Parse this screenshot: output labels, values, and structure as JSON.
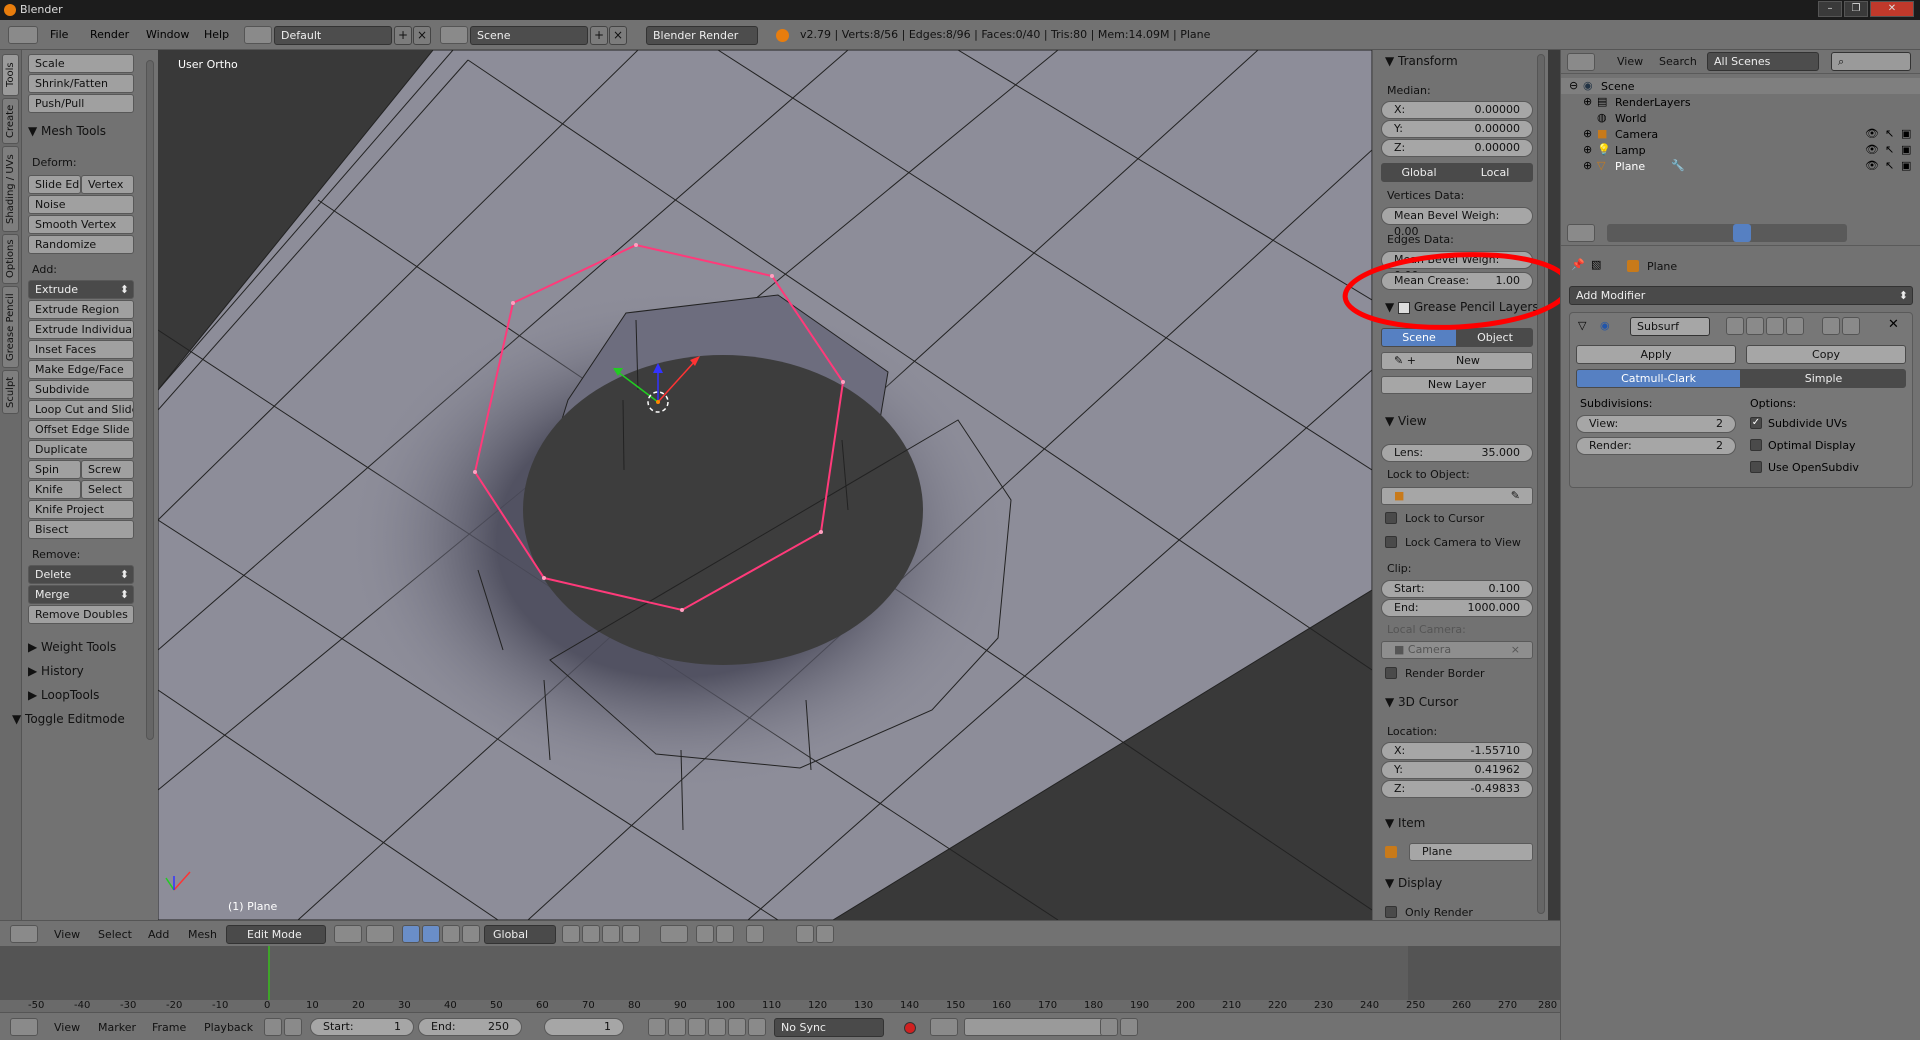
{
  "titlebar": {
    "title": "Blender",
    "min": "–",
    "max": "❐",
    "close": "✕"
  },
  "info": {
    "menus": [
      "File",
      "Render",
      "Window",
      "Help"
    ],
    "layout": "Default",
    "scene": "Scene",
    "engine": "Blender Render",
    "stats": "v2.79 | Verts:8/56 | Edges:8/96 | Faces:0/40 | Tris:80 | Mem:14.09M | Plane"
  },
  "tabs": [
    "Tools",
    "Create",
    "Shading / UVs",
    "Options",
    "Grease Pencil",
    "Sculpt"
  ],
  "tools": {
    "top_buttons": [
      "Scale",
      "Shrink/Fatten",
      "Push/Pull"
    ],
    "mesh_tools": "Mesh Tools",
    "deform": "Deform:",
    "deform_pair": [
      "Slide Ed",
      "Vertex"
    ],
    "deform_buttons": [
      "Noise",
      "Smooth Vertex",
      "Randomize"
    ],
    "add": "Add:",
    "extrude": "Extrude",
    "add_buttons": [
      "Extrude Region",
      "Extrude Individual",
      "Inset Faces",
      "Make Edge/Face",
      "Subdivide",
      "Loop Cut and Slide",
      "Offset Edge Slide",
      "Duplicate"
    ],
    "spin_pair": [
      "Spin",
      "Screw"
    ],
    "knife_pair": [
      "Knife",
      "Select"
    ],
    "more_buttons": [
      "Knife Project",
      "Bisect"
    ],
    "remove": "Remove:",
    "delete": "Delete",
    "merge": "Merge",
    "remove_doubles": "Remove Doubles",
    "collapsed": [
      "Weight Tools",
      "History",
      "LoopTools"
    ],
    "toggle": "Toggle Editmode"
  },
  "viewport": {
    "view_name": "User Ortho",
    "object_label": "(1) Plane"
  },
  "npanel": {
    "transform": "Transform",
    "median": "Median:",
    "x_label": "X:",
    "x": "0.00000",
    "y_label": "Y:",
    "y": "0.00000",
    "z_label": "Z:",
    "z": "0.00000",
    "global": "Global",
    "local": "Local",
    "vertices_data": "Vertices Data:",
    "mean_bevel_v": "Mean Bevel Weigh: 0.00",
    "edges_data": "Edges Data:",
    "mean_bevel_e": "Mean Bevel Weigh: 0.00",
    "mean_crease_label": "Mean Crease:",
    "mean_crease": "1.00",
    "gp_layers": "Grease Pencil Layers",
    "gp_scene": "Scene",
    "gp_object": "Object",
    "gp_new": "New",
    "new_layer": "New Layer",
    "view": "View",
    "lens_label": "Lens:",
    "lens": "35.000",
    "lock_to_object": "Lock to Object:",
    "lock_to_cursor": "Lock to Cursor",
    "lock_camera": "Lock Camera to View",
    "clip": "Clip:",
    "start_label": "Start:",
    "start": "0.100",
    "end_label": "End:",
    "end": "1000.000",
    "local_camera": "Local Camera:",
    "camera": "Camera",
    "render_border": "Render Border",
    "cursor": "3D Cursor",
    "location": "Location:",
    "cx_label": "X:",
    "cx": "-1.55710",
    "cy_label": "Y:",
    "cy": "0.41962",
    "cz_label": "Z:",
    "cz": "-0.49833",
    "item": "Item",
    "item_name": "Plane",
    "display": "Display",
    "only_render": "Only Render"
  },
  "outliner": {
    "menus": [
      "View",
      "Search"
    ],
    "filter": "All Scenes",
    "items": [
      "Scene",
      "RenderLayers",
      "World",
      "Camera",
      "Lamp",
      "Plane"
    ]
  },
  "properties": {
    "object": "Plane",
    "add_modifier": "Add Modifier",
    "modifier_name": "Subsurf",
    "apply": "Apply",
    "copy": "Copy",
    "catmull": "Catmull-Clark",
    "simple": "Simple",
    "subdivisions": "Subdivisions:",
    "options": "Options:",
    "view_label": "View:",
    "view_val": "2",
    "render_label": "Render:",
    "render_val": "2",
    "opt1": "Subdivide UVs",
    "opt2": "Optimal Display",
    "opt3": "Use OpenSubdiv"
  },
  "vp_header": {
    "menus": [
      "View",
      "Select",
      "Add",
      "Mesh"
    ],
    "mode": "Edit Mode",
    "orientation": "Global"
  },
  "timeline": {
    "ticks": [
      "-50",
      "-40",
      "-30",
      "-20",
      "-10",
      "0",
      "10",
      "20",
      "30",
      "40",
      "50",
      "60",
      "70",
      "80",
      "90",
      "100",
      "110",
      "120",
      "130",
      "140",
      "150",
      "160",
      "170",
      "180",
      "190",
      "200",
      "210",
      "220",
      "230",
      "240",
      "250",
      "260",
      "270",
      "280"
    ]
  },
  "tl_header": {
    "menus": [
      "View",
      "Marker",
      "Frame",
      "Playback"
    ],
    "start_label": "Start:",
    "start": "1",
    "end_label": "End:",
    "end": "250",
    "current": "1",
    "sync": "No Sync"
  },
  "colors": {
    "selection": "#ff3a7a",
    "annotation": "#ff0000",
    "accent": "#5680c2"
  }
}
